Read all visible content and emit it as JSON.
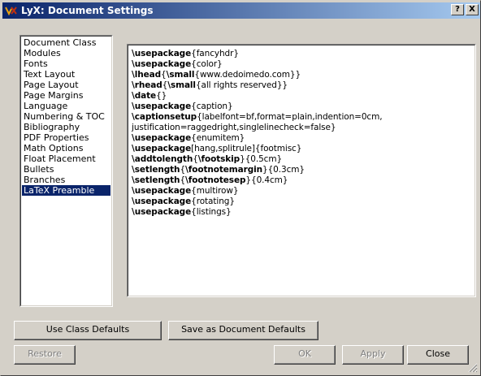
{
  "window": {
    "title": "LyX: Document Settings",
    "help_label": "?",
    "close_label": "X"
  },
  "sidebar": {
    "items": [
      {
        "label": "Document Class"
      },
      {
        "label": "Modules"
      },
      {
        "label": "Fonts"
      },
      {
        "label": "Text Layout"
      },
      {
        "label": "Page Layout"
      },
      {
        "label": "Page Margins"
      },
      {
        "label": "Language"
      },
      {
        "label": "Numbering & TOC"
      },
      {
        "label": "Bibliography"
      },
      {
        "label": "PDF Properties"
      },
      {
        "label": "Math Options"
      },
      {
        "label": "Float Placement"
      },
      {
        "label": "Bullets"
      },
      {
        "label": "Branches"
      },
      {
        "label": "LaTeX Preamble"
      }
    ],
    "selected": "LaTeX Preamble"
  },
  "preamble": {
    "lines": [
      {
        "parts": [
          {
            "b": "\\usepackage"
          },
          {
            "t": "{fancyhdr}"
          }
        ]
      },
      {
        "parts": [
          {
            "b": "\\usepackage"
          },
          {
            "t": "{color}"
          }
        ]
      },
      {
        "parts": [
          {
            "b": "\\lhead"
          },
          {
            "t": "{"
          },
          {
            "b": "\\small"
          },
          {
            "t": "{www.dedoimedo.com}}"
          }
        ]
      },
      {
        "parts": [
          {
            "b": "\\rhead"
          },
          {
            "t": "{"
          },
          {
            "b": "\\small"
          },
          {
            "t": "{all rights reserved}}"
          }
        ]
      },
      {
        "parts": [
          {
            "b": "\\date"
          },
          {
            "t": "{}"
          }
        ]
      },
      {
        "parts": [
          {
            "b": "\\usepackage"
          },
          {
            "t": "{caption}"
          }
        ]
      },
      {
        "parts": [
          {
            "b": "\\captionsetup"
          },
          {
            "t": "{labelfont=bf,format=plain,indention=0cm,"
          }
        ]
      },
      {
        "parts": [
          {
            "t": "justification=raggedright,singlelinecheck=false}"
          }
        ]
      },
      {
        "parts": [
          {
            "b": "\\usepackage"
          },
          {
            "t": "{enumitem}"
          }
        ]
      },
      {
        "parts": [
          {
            "b": "\\usepackage"
          },
          {
            "t": "[hang,splitrule]{footmisc}"
          }
        ]
      },
      {
        "parts": [
          {
            "b": "\\addtolength"
          },
          {
            "t": "{"
          },
          {
            "b": "\\footskip"
          },
          {
            "t": "}{0.5cm}"
          }
        ]
      },
      {
        "parts": [
          {
            "b": "\\setlength"
          },
          {
            "t": "{"
          },
          {
            "b": "\\footnotemargin"
          },
          {
            "t": "}{0.3cm}"
          }
        ]
      },
      {
        "parts": [
          {
            "b": "\\setlength"
          },
          {
            "t": "{"
          },
          {
            "b": "\\footnotesep"
          },
          {
            "t": "}{0.4cm}"
          }
        ]
      },
      {
        "parts": [
          {
            "b": "\\usepackage"
          },
          {
            "t": "{multirow}"
          }
        ]
      },
      {
        "parts": [
          {
            "b": "\\usepackage"
          },
          {
            "t": "{rotating}"
          }
        ]
      },
      {
        "parts": [
          {
            "b": "\\usepackage"
          },
          {
            "t": "{listings}"
          }
        ]
      }
    ]
  },
  "buttons": {
    "use_class_defaults": "Use Class Defaults",
    "save_as_document_defaults": "Save as Document Defaults",
    "restore": "Restore",
    "ok": "OK",
    "apply": "Apply",
    "close": "Close"
  },
  "colors": {
    "title_gradient_start": "#0a246a",
    "title_gradient_end": "#a6caf0",
    "selection": "#0a246a",
    "face": "#d4d0c8"
  }
}
